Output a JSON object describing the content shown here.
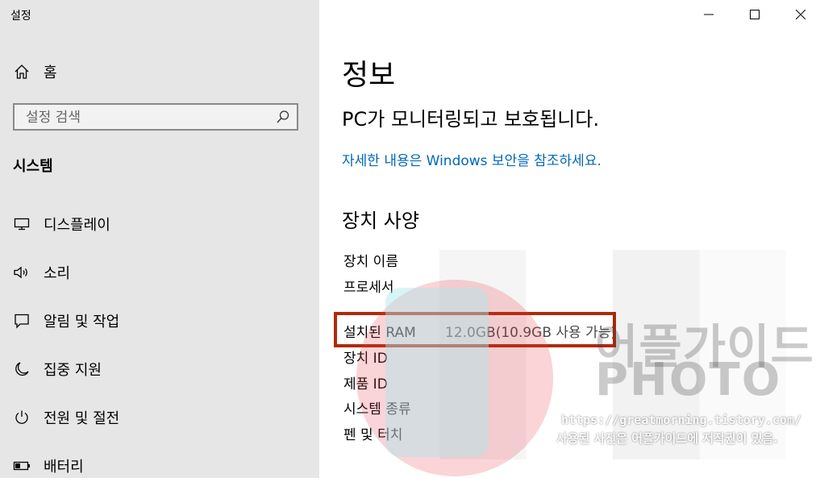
{
  "window": {
    "title": "설정",
    "minimize_icon": "minimize-icon",
    "maximize_icon": "maximize-icon",
    "close_icon": "close-icon"
  },
  "sidebar": {
    "home": {
      "label": "홈",
      "icon": "home-icon"
    },
    "search": {
      "placeholder": "설정 검색",
      "icon": "search-icon"
    },
    "section_heading": "시스템",
    "items": [
      {
        "label": "디스플레이",
        "icon": "display-icon"
      },
      {
        "label": "소리",
        "icon": "speaker-icon"
      },
      {
        "label": "알림 및 작업",
        "icon": "notification-icon"
      },
      {
        "label": "집중 지원",
        "icon": "moon-icon"
      },
      {
        "label": "전원 및 절전",
        "icon": "power-icon"
      },
      {
        "label": "배터리",
        "icon": "battery-icon"
      }
    ]
  },
  "main": {
    "title": "정보",
    "protection_status": "PC가 모니터링되고 보호됩니다.",
    "security_link": "자세한 내용은 Windows 보안을 참조하세요.",
    "spec_heading": "장치 사양",
    "specs": [
      {
        "key": "장치 이름",
        "value": ""
      },
      {
        "key": "프로세서",
        "value": ""
      },
      {
        "key": "설치된 RAM",
        "value": "12.0GB(10.9GB 사용 가능)"
      },
      {
        "key": "장치 ID",
        "value": ""
      },
      {
        "key": "제품 ID",
        "value": ""
      },
      {
        "key": "시스템 종류",
        "value": ""
      },
      {
        "key": "펜 및 터치",
        "value": ""
      }
    ],
    "highlight_color": "#b02a0a"
  },
  "watermark": {
    "brand": "어플가이드",
    "photo": "PHOTO",
    "url": "https://greatmorning.tistory.com/",
    "copyright": "사용된 사진은 어플가이드에 저작권이 있음."
  }
}
